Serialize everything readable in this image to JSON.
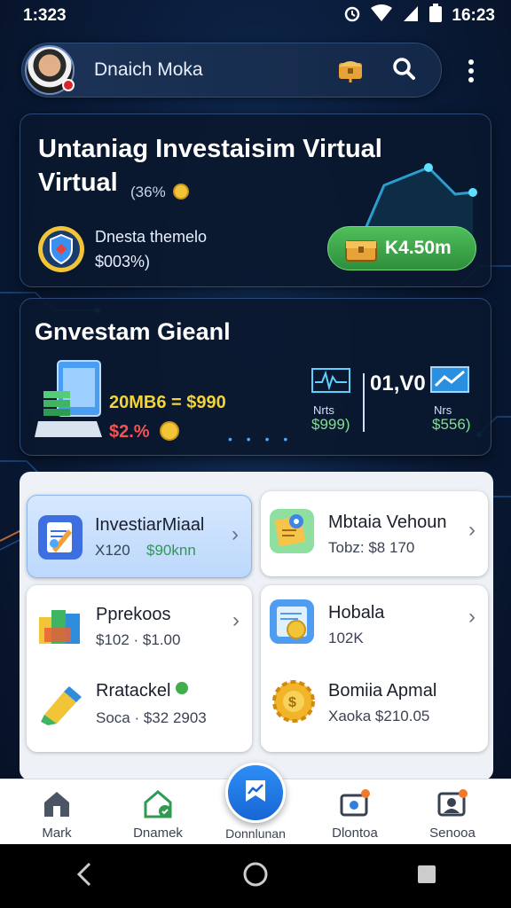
{
  "status_bar": {
    "left_time": "1:323",
    "right_time": "16:23",
    "icons": [
      "alarm-icon",
      "wifi-icon",
      "signal-icon",
      "battery-icon"
    ]
  },
  "header": {
    "user_name": "Dnaich Moka",
    "icons": [
      "treasure-chest-icon",
      "search-icon",
      "more-vert-icon"
    ]
  },
  "hero_card": {
    "title": "Untaniag Investaisim Virtual Virtual",
    "percent": "(36%",
    "subtitle_line1": "Dnesta themelo",
    "subtitle_line2": "$003%)",
    "pill_amount": "K4.50m"
  },
  "invest_card": {
    "title": "Gnvestam Gieanl",
    "value_line": "20MB6 = $990",
    "change": "$2.%",
    "right_big": "01,V0",
    "stat_left_label": "Nrts",
    "stat_left_value": "$999)",
    "stat_right_label": "Nrs",
    "stat_right_value": "$556)"
  },
  "tiles": [
    {
      "title": "InvestiarMiaal",
      "sub1": "X120",
      "sub2": "$90knn",
      "icon": "document-edit-icon",
      "selected": true
    },
    {
      "title": "Mbtaia Vehoun",
      "sub1": "Tobz: $8 170",
      "icon": "map-pin-icon",
      "selected": false
    },
    {
      "title": "Pprekoos",
      "sub1": "$102 · $1.00",
      "icon": "books-icon",
      "selected": false
    },
    {
      "title": "Hobala",
      "sub1": "102K",
      "icon": "coin-card-icon",
      "selected": false
    },
    {
      "title": "Rratackel",
      "sub1": "Soca · $32 2903",
      "icon": "marker-icon",
      "selected": false
    },
    {
      "title": "Bomiia Apmal",
      "sub1": "Xaoka $210.05",
      "icon": "gear-coin-icon",
      "selected": false
    }
  ],
  "bottom_nav": [
    {
      "label": "Mark",
      "icon": "home-icon"
    },
    {
      "label": "Dnamek",
      "icon": "house-check-icon"
    },
    {
      "label": "Donnlunan",
      "icon": "chart-bookmark-icon"
    },
    {
      "label": "Dlontoa",
      "icon": "camera-notify-icon"
    },
    {
      "label": "Senooa",
      "icon": "profile-icon"
    }
  ],
  "colors": {
    "accent_green": "#3fae4c",
    "accent_blue": "#1f7ce8",
    "yellow": "#f2d33a",
    "red": "#f05555"
  }
}
